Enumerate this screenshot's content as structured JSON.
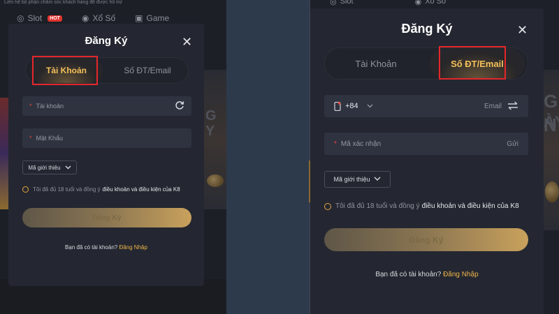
{
  "left_panel": {
    "ticker": "Liên hệ bộ phận chăm sóc khách hàng để được hỗ trợ",
    "nav": [
      {
        "label": "Slot",
        "badge": "HOT"
      },
      {
        "label": "Xổ Số"
      },
      {
        "label": "Game"
      }
    ],
    "modal": {
      "title": "Đăng Ký",
      "tabs": [
        {
          "label": "Tài Khoản",
          "active": true
        },
        {
          "label": "Số ĐT/Email",
          "active": false
        }
      ],
      "username_placeholder": "Tài khoản",
      "password_placeholder": "Mật Khẩu",
      "referral_label": "Mã giới thiệu",
      "agree_text": "Tôi đã đủ 18 tuổi và đồng ý",
      "agree_link": "điều khoản và điều kiện của K8",
      "submit_label": "Đăng Ký",
      "have_account": "Bạn đã có tài khoản?",
      "login_link": "Đăng Nhập"
    }
  },
  "right_panel": {
    "nav": [
      {
        "label": "Slot"
      },
      {
        "label": "Xổ Số"
      }
    ],
    "promo_text": [
      "G N",
      "ÀY"
    ],
    "modal": {
      "title": "Đăng Ký",
      "tabs": [
        {
          "label": "Tài Khoản",
          "active": false
        },
        {
          "label": "Số ĐT/Email",
          "active": true
        }
      ],
      "country_code": "+84",
      "email_switch_label": "Email",
      "otp_placeholder": "Mã xác nhận",
      "send_label": "Gửi",
      "referral_label": "Mã giới thiệu",
      "agree_text": "Tôi đã đủ 18 tuổi và đồng ý",
      "agree_link": "điều khoản và điều kiện của K8",
      "submit_label": "Đăng Ký",
      "have_account": "Bạn đã có tài khoản?",
      "login_link": "Đăng Nhập"
    }
  },
  "colors": {
    "accent": "#f0b548",
    "highlight_box": "#e5262b",
    "modal_bg": "#242731",
    "field_bg": "#2f3340"
  }
}
